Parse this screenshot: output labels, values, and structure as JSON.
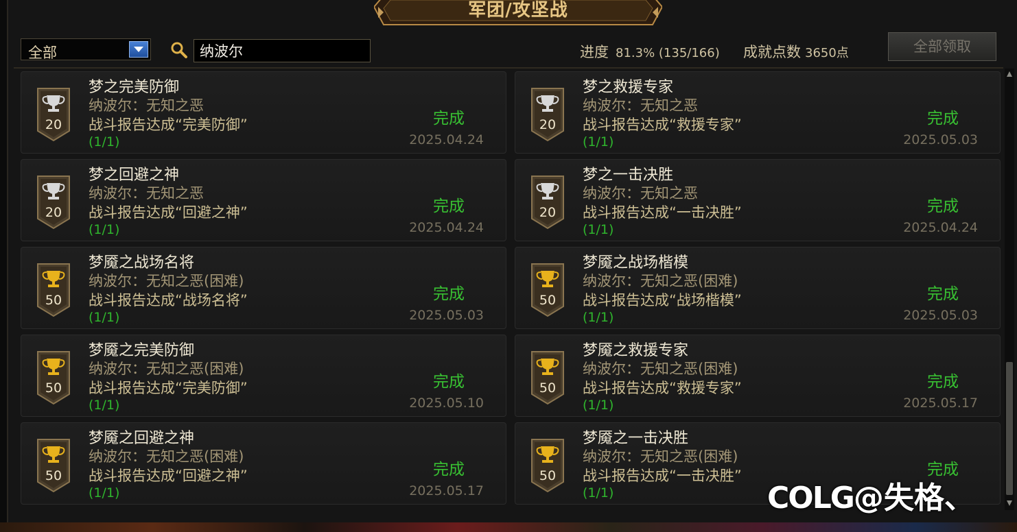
{
  "window": {
    "title": "军团/攻坚战"
  },
  "toolbar": {
    "filter_selected": "全部",
    "search_icon": "search-icon",
    "search_value": "纳波尔",
    "progress_label": "进度",
    "progress_value": "81.3% (135/166)",
    "progress_fraction": 0.813,
    "points_label": "成就点数",
    "points_value": "3650点",
    "claim_all_label": "全部领取"
  },
  "achievements": [
    {
      "title": "梦之完美防御",
      "boss": "纳波尔：无知之恶",
      "desc": "战斗报告达成“完美防御”",
      "count": "(1/1)",
      "points": "20",
      "tier": "silver",
      "status": "完成",
      "date": "2025.04.24"
    },
    {
      "title": "梦之救援专家",
      "boss": "纳波尔：无知之恶",
      "desc": "战斗报告达成“救援专家”",
      "count": "(1/1)",
      "points": "20",
      "tier": "silver",
      "status": "完成",
      "date": "2025.05.03"
    },
    {
      "title": "梦之回避之神",
      "boss": "纳波尔：无知之恶",
      "desc": "战斗报告达成“回避之神”",
      "count": "(1/1)",
      "points": "20",
      "tier": "silver",
      "status": "完成",
      "date": "2025.04.24"
    },
    {
      "title": "梦之一击决胜",
      "boss": "纳波尔：无知之恶",
      "desc": "战斗报告达成“一击决胜”",
      "count": "(1/1)",
      "points": "20",
      "tier": "silver",
      "status": "完成",
      "date": "2025.04.24"
    },
    {
      "title": "梦魇之战场名将",
      "boss": "纳波尔：无知之恶(困难)",
      "desc": "战斗报告达成“战场名将”",
      "count": "(1/1)",
      "points": "50",
      "tier": "gold",
      "status": "完成",
      "date": "2025.05.03"
    },
    {
      "title": "梦魇之战场楷模",
      "boss": "纳波尔：无知之恶(困难)",
      "desc": "战斗报告达成“战场楷模”",
      "count": "(1/1)",
      "points": "50",
      "tier": "gold",
      "status": "完成",
      "date": "2025.05.03"
    },
    {
      "title": "梦魇之完美防御",
      "boss": "纳波尔：无知之恶(困难)",
      "desc": "战斗报告达成“完美防御”",
      "count": "(1/1)",
      "points": "50",
      "tier": "gold",
      "status": "完成",
      "date": "2025.05.10"
    },
    {
      "title": "梦魇之救援专家",
      "boss": "纳波尔：无知之恶(困难)",
      "desc": "战斗报告达成“救援专家”",
      "count": "(1/1)",
      "points": "50",
      "tier": "gold",
      "status": "完成",
      "date": "2025.05.17"
    },
    {
      "title": "梦魇之回避之神",
      "boss": "纳波尔：无知之恶(困难)",
      "desc": "战斗报告达成“回避之神”",
      "count": "(1/1)",
      "points": "50",
      "tier": "gold",
      "status": "完成",
      "date": "2025.05.17"
    },
    {
      "title": "梦魇之一击决胜",
      "boss": "纳波尔：无知之恶(困难)",
      "desc": "战斗报告达成“一击决胜”",
      "count": "(1/1)",
      "points": "50",
      "tier": "gold",
      "status": "完成",
      "date": ""
    }
  ],
  "watermark": {
    "logo": "COLG",
    "text": "@失格、"
  },
  "colors": {
    "status_green": "#38c032",
    "count_green": "#2fb52d",
    "title_gold": "#e7c684",
    "trophy_silver": "#d8d8d8",
    "trophy_gold": "#e8b21c"
  }
}
